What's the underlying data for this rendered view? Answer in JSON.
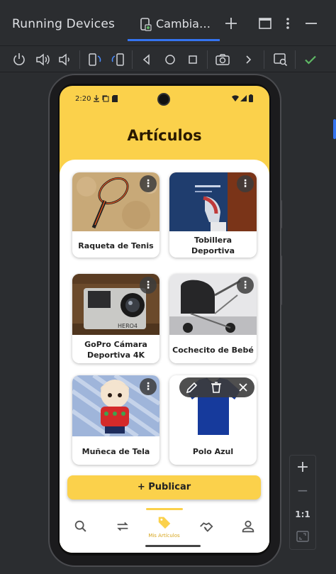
{
  "ide": {
    "panel_title": "Running Devices",
    "tab_label": "Cambia…",
    "icons": {
      "add": "plus-icon",
      "window": "restore-window-icon",
      "menu": "kebab-icon",
      "minimize": "minimize-icon"
    }
  },
  "toolbar": {
    "items": [
      "power-icon",
      "volume-up-icon",
      "volume-down-icon",
      "rotate-left-icon",
      "rotate-right-icon",
      "back-icon",
      "home-icon",
      "overview-icon",
      "screenshot-icon",
      "more-chevron-icon",
      "layout-inspector-icon",
      "check-icon"
    ],
    "check_color": "#5fb865"
  },
  "phone": {
    "status_time": "2:20",
    "page_title": "Artículos",
    "accent": "#fbd14b",
    "items": [
      {
        "label": "Raqueta de Tenis"
      },
      {
        "label": "Tobillera Deportiva"
      },
      {
        "label": "GoPro Cámara Deportiva 4K"
      },
      {
        "label": "Cochecito de Bebé"
      },
      {
        "label": "Muñeca de Tela"
      },
      {
        "label": "Polo Azul"
      }
    ],
    "publish_label": "+ Publicar",
    "nav": {
      "active_label": "Mis Artículos"
    }
  },
  "zoom": {
    "plus": "+",
    "minus": "−",
    "ratio": "1:1"
  }
}
